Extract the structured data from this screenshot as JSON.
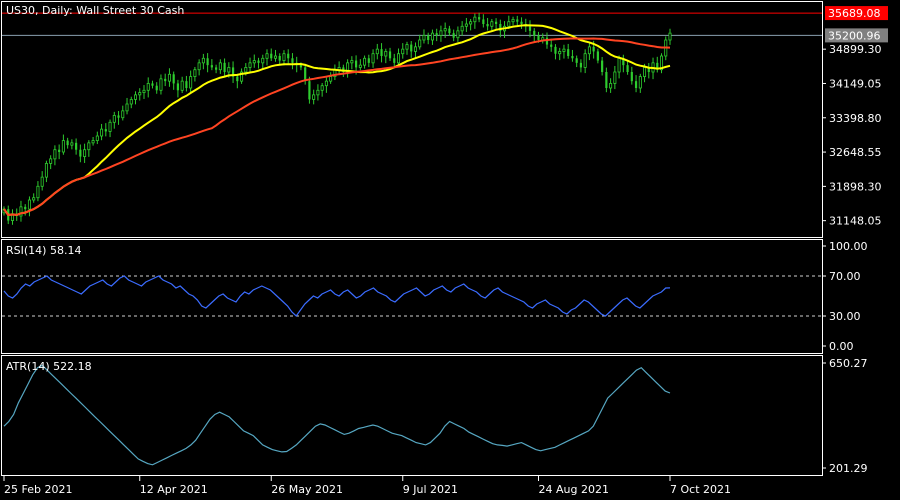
{
  "colors": {
    "background": "#000000",
    "frame": "#ffffff",
    "candle": "#2ecc2e",
    "ma_fast": "#ffff00",
    "ma_slow": "#ff4422",
    "rsi": "#3b6cff",
    "atr": "#56a7c2",
    "price_badge_last": "#ff0000",
    "price_badge_ref": "#808080",
    "hline_last": "#ff0000",
    "hline_ref": "#8aa0b0"
  },
  "chart_data": [
    {
      "type": "candlestick",
      "title": "US30, Daily:  Wall Street 30 Cash",
      "ylim": [
        30900,
        35800
      ],
      "y_ticks": [
        "34899.30",
        "34149.05",
        "33398.80",
        "32648.55",
        "31898.30",
        "31148.05"
      ],
      "badges": [
        {
          "label": "35689.08",
          "value": 35689.08,
          "style": "last"
        },
        {
          "label": "35200.96",
          "value": 35200.96,
          "style": "ref"
        }
      ],
      "x_ticks": [
        {
          "label": "25 Feb 2021",
          "index": 0
        },
        {
          "label": "12 Apr 2021",
          "index": 32
        },
        {
          "label": "26 May 2021",
          "index": 63
        },
        {
          "label": "9 Jul 2021",
          "index": 94
        },
        {
          "label": "24 Aug 2021",
          "index": 126
        },
        {
          "label": "7 Oct 2021",
          "index": 157
        }
      ],
      "close": [
        31400,
        31150,
        31300,
        31250,
        31450,
        31400,
        31600,
        31650,
        31900,
        32100,
        32400,
        32500,
        32700,
        32650,
        32900,
        32800,
        32850,
        32700,
        32550,
        32700,
        32850,
        32900,
        33000,
        33150,
        33100,
        33300,
        33450,
        33400,
        33550,
        33700,
        33800,
        33900,
        33950,
        34000,
        34150,
        34100,
        34000,
        34250,
        34200,
        34350,
        34150,
        34000,
        34200,
        34050,
        34300,
        34450,
        34600,
        34700,
        34550,
        34500,
        34450,
        34600,
        34400,
        34500,
        34300,
        34200,
        34400,
        34500,
        34600,
        34650,
        34600,
        34700,
        34800,
        34700,
        34750,
        34650,
        34800,
        34700,
        34600,
        34550,
        34500,
        34200,
        33800,
        33900,
        34000,
        34100,
        34200,
        34300,
        34450,
        34500,
        34400,
        34600,
        34650,
        34500,
        34550,
        34700,
        34600,
        34800,
        34900,
        34750,
        34850,
        34700,
        34600,
        34800,
        34900,
        35000,
        34850,
        34950,
        35100,
        35200,
        35100,
        35250,
        35200,
        35300,
        35350,
        35250,
        35150,
        35300,
        35400,
        35450,
        35500,
        35600,
        35550,
        35450,
        35400,
        35500,
        35450,
        35300,
        35400,
        35500,
        35550,
        35500,
        35450,
        35400,
        35300,
        35200,
        35100,
        35150,
        35000,
        34950,
        34800,
        34850,
        34900,
        34750,
        34700,
        34600,
        34500,
        34800,
        34950,
        34850,
        34650,
        34400,
        34050,
        34150,
        34400,
        34700,
        34550,
        34400,
        34200,
        34050,
        34300,
        34500,
        34400,
        34600,
        34450,
        34750,
        35100,
        35250
      ],
      "series": [
        {
          "name": "",
          "key": "ma_fast",
          "period": 20
        },
        {
          "name": "",
          "key": "ma_slow",
          "period": 50
        }
      ]
    },
    {
      "type": "line",
      "title": "RSI(14) 58.14",
      "ylim": [
        0,
        100
      ],
      "y_ticks": [
        "100.00",
        "70.00",
        "30.00",
        "0.00"
      ],
      "levels": [
        70,
        30
      ],
      "values": [
        55,
        50,
        48,
        52,
        58,
        62,
        60,
        64,
        66,
        68,
        70,
        66,
        64,
        62,
        60,
        58,
        56,
        54,
        52,
        56,
        60,
        62,
        64,
        66,
        62,
        60,
        64,
        68,
        70,
        66,
        64,
        62,
        60,
        64,
        66,
        68,
        70,
        66,
        64,
        62,
        58,
        60,
        56,
        52,
        50,
        46,
        40,
        38,
        42,
        46,
        50,
        52,
        48,
        46,
        44,
        50,
        54,
        52,
        56,
        58,
        60,
        58,
        56,
        52,
        48,
        44,
        40,
        34,
        30,
        36,
        42,
        46,
        50,
        48,
        52,
        54,
        56,
        52,
        50,
        54,
        56,
        52,
        48,
        50,
        54,
        56,
        58,
        54,
        52,
        50,
        46,
        44,
        48,
        52,
        54,
        56,
        58,
        54,
        50,
        52,
        56,
        58,
        60,
        56,
        54,
        58,
        60,
        62,
        58,
        56,
        54,
        50,
        48,
        52,
        56,
        58,
        54,
        52,
        50,
        48,
        46,
        44,
        40,
        38,
        42,
        44,
        46,
        42,
        40,
        38,
        34,
        32,
        36,
        38,
        42,
        46,
        44,
        40,
        36,
        32,
        30,
        34,
        38,
        42,
        46,
        48,
        44,
        40,
        38,
        42,
        46,
        50,
        52,
        54,
        58,
        58.14
      ],
      "series": [
        {
          "name": "",
          "key": "rsi"
        }
      ]
    },
    {
      "type": "line",
      "title": "ATR(14) 522.18",
      "ylim": [
        201.29,
        650.27
      ],
      "y_ticks": [
        "650.27",
        "201.29"
      ],
      "values": [
        380,
        400,
        430,
        480,
        520,
        560,
        600,
        630,
        640,
        620,
        600,
        580,
        560,
        540,
        520,
        500,
        480,
        460,
        440,
        420,
        400,
        380,
        360,
        340,
        320,
        300,
        280,
        260,
        240,
        230,
        220,
        215,
        225,
        235,
        245,
        255,
        265,
        275,
        285,
        300,
        320,
        350,
        380,
        410,
        430,
        440,
        430,
        420,
        400,
        380,
        360,
        350,
        340,
        320,
        300,
        290,
        280,
        275,
        270,
        272,
        285,
        300,
        320,
        340,
        360,
        380,
        390,
        385,
        375,
        365,
        355,
        345,
        350,
        360,
        370,
        375,
        380,
        385,
        380,
        370,
        360,
        350,
        345,
        340,
        330,
        320,
        310,
        305,
        300,
        310,
        330,
        350,
        380,
        400,
        390,
        380,
        370,
        355,
        345,
        335,
        325,
        315,
        305,
        300,
        298,
        295,
        300,
        305,
        310,
        300,
        290,
        280,
        275,
        280,
        285,
        290,
        300,
        310,
        320,
        330,
        340,
        350,
        360,
        380,
        420,
        460,
        500,
        520,
        540,
        560,
        580,
        600,
        620,
        630,
        610,
        590,
        570,
        550,
        530,
        522.18
      ],
      "series": [
        {
          "name": "",
          "key": "atr"
        }
      ]
    }
  ]
}
